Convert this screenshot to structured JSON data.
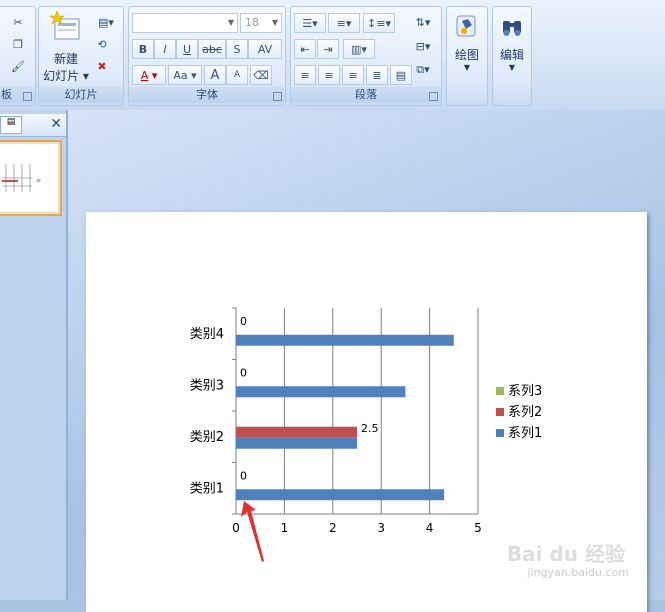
{
  "ribbon": {
    "clipboard_label": "板",
    "slides_group": {
      "label": "幻灯片",
      "new_slide_line1": "新建",
      "new_slide_line2": "幻灯片"
    },
    "font_group": {
      "label": "字体",
      "font_name_placeholder": "",
      "font_size": "18",
      "bold": "B",
      "italic": "I",
      "underline": "U",
      "strike": "abc",
      "shadow": "S",
      "spacing": "AV",
      "color": "A",
      "case": "Aa",
      "grow": "A",
      "shrink": "A"
    },
    "para_group": {
      "label": "段落"
    },
    "drawing": {
      "label": "绘图"
    },
    "editing": {
      "label": "编辑"
    }
  },
  "chart_data": {
    "type": "bar",
    "orientation": "horizontal",
    "categories": [
      "类别1",
      "类别2",
      "类别3",
      "类别4"
    ],
    "series": [
      {
        "name": "系列1",
        "values": [
          4.3,
          2.5,
          3.5,
          4.5
        ],
        "color": "#4f81bd"
      },
      {
        "name": "系列2",
        "values": [
          0,
          2.5,
          0,
          0
        ],
        "color": "#c0504d"
      },
      {
        "name": "系列3",
        "values": [
          0,
          0,
          0,
          0
        ],
        "color": "#9bbb59"
      }
    ],
    "data_labels": [
      {
        "category": "类别1",
        "text": "0"
      },
      {
        "category": "类别2",
        "text": "2.5"
      },
      {
        "category": "类别3",
        "text": "0"
      },
      {
        "category": "类别4",
        "text": "0"
      }
    ],
    "xlim": [
      0,
      5
    ],
    "xticks": [
      "0",
      "1",
      "2",
      "3",
      "4",
      "5"
    ],
    "grid": true,
    "legend_position": "right",
    "legend_order": [
      "系列3",
      "系列2",
      "系列1"
    ]
  },
  "watermark": {
    "text": "Bai du 经验",
    "sub": "jingyan.baidu.com"
  },
  "annotation": {
    "arrow_color": "#e03030"
  }
}
